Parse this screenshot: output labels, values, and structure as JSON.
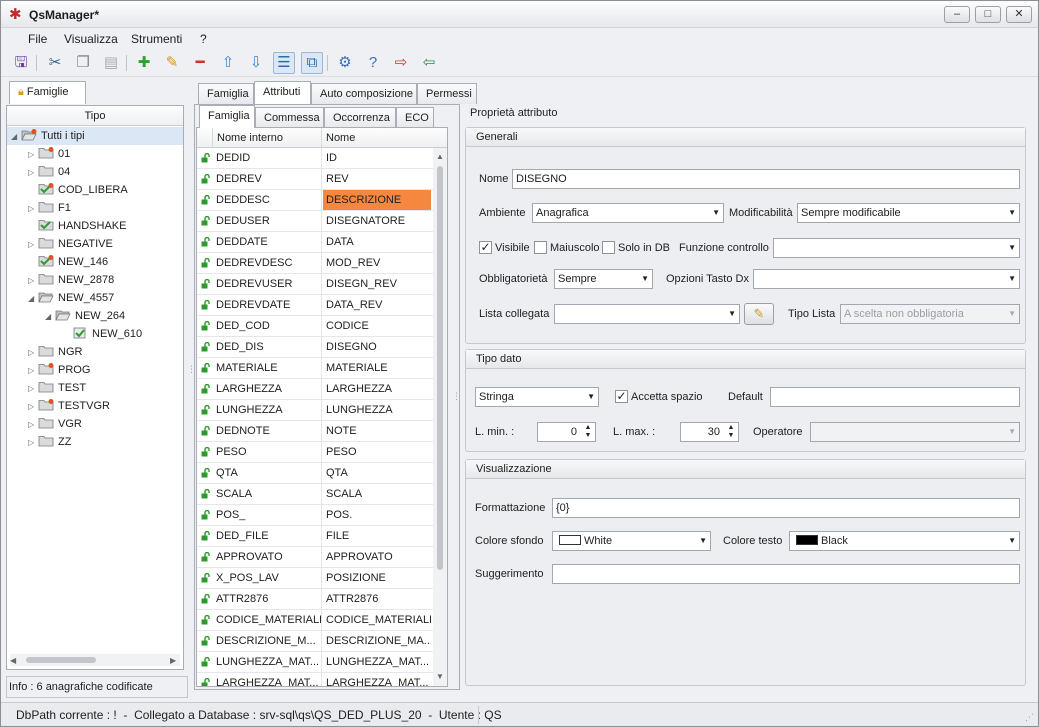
{
  "window": {
    "title": "QsManager*"
  },
  "menu": [
    "File",
    "Visualizza",
    "Strumenti",
    "?"
  ],
  "left_tab": "Famiglie",
  "tree": {
    "header": "Tipo",
    "root": "Tutti i tipi",
    "items": [
      {
        "label": "01",
        "depth": 1,
        "arrow": "right",
        "icon": "folder-star"
      },
      {
        "label": "04",
        "depth": 1,
        "arrow": "right",
        "icon": "folder"
      },
      {
        "label": "COD_LIBERA",
        "depth": 1,
        "arrow": "",
        "icon": "folder-check-star"
      },
      {
        "label": "F1",
        "depth": 1,
        "arrow": "right",
        "icon": "folder"
      },
      {
        "label": "HANDSHAKE",
        "depth": 1,
        "arrow": "",
        "icon": "folder-check"
      },
      {
        "label": "NEGATIVE",
        "depth": 1,
        "arrow": "right",
        "icon": "folder"
      },
      {
        "label": "NEW_146",
        "depth": 1,
        "arrow": "",
        "icon": "folder-check-star"
      },
      {
        "label": "NEW_2878",
        "depth": 1,
        "arrow": "right",
        "icon": "folder"
      },
      {
        "label": "NEW_4557",
        "depth": 1,
        "arrow": "down",
        "icon": "folder-open"
      },
      {
        "label": "NEW_264",
        "depth": 2,
        "arrow": "down",
        "icon": "folder-open"
      },
      {
        "label": "NEW_610",
        "depth": 3,
        "arrow": "",
        "icon": "check"
      },
      {
        "label": "NGR",
        "depth": 1,
        "arrow": "right",
        "icon": "folder"
      },
      {
        "label": "PROG",
        "depth": 1,
        "arrow": "right",
        "icon": "folder-star"
      },
      {
        "label": "TEST",
        "depth": 1,
        "arrow": "right",
        "icon": "folder"
      },
      {
        "label": "TESTVGR",
        "depth": 1,
        "arrow": "right",
        "icon": "folder-star"
      },
      {
        "label": "VGR",
        "depth": 1,
        "arrow": "right",
        "icon": "folder"
      },
      {
        "label": "ZZ",
        "depth": 1,
        "arrow": "right",
        "icon": "folder"
      }
    ]
  },
  "info": "Info : 6 anagrafiche codificate",
  "tabs_main": [
    "Famiglia",
    "Attributi",
    "Auto composizione",
    "Permessi"
  ],
  "tabs_sub": [
    "Famiglia",
    "Commessa",
    "Occorrenza",
    "ECO"
  ],
  "grid": {
    "headers": [
      "Nome interno",
      "Nome"
    ],
    "rows": [
      [
        "DEDID",
        "ID"
      ],
      [
        "DEDREV",
        "REV"
      ],
      [
        "DEDDESC",
        "DESCRIZIONE"
      ],
      [
        "DEDUSER",
        "DISEGNATORE"
      ],
      [
        "DEDDATE",
        "DATA"
      ],
      [
        "DEDREVDESC",
        "MOD_REV"
      ],
      [
        "DEDREVUSER",
        "DISEGN_REV"
      ],
      [
        "DEDREVDATE",
        "DATA_REV"
      ],
      [
        "DED_COD",
        "CODICE"
      ],
      [
        "DED_DIS",
        "DISEGNO"
      ],
      [
        "MATERIALE",
        "MATERIALE"
      ],
      [
        "LARGHEZZA",
        "LARGHEZZA"
      ],
      [
        "LUNGHEZZA",
        "LUNGHEZZA"
      ],
      [
        "DEDNOTE",
        "NOTE"
      ],
      [
        "PESO",
        "PESO"
      ],
      [
        "QTA",
        "QTA"
      ],
      [
        "SCALA",
        "SCALA"
      ],
      [
        "POS_",
        "POS."
      ],
      [
        "DED_FILE",
        "FILE"
      ],
      [
        "APPROVATO",
        "APPROVATO"
      ],
      [
        "X_POS_LAV",
        "POSIZIONE"
      ],
      [
        "ATTR2876",
        "ATTR2876"
      ],
      [
        "CODICE_MATERIALE",
        "CODICE_MATERIALE"
      ],
      [
        "DESCRIZIONE_M...",
        "DESCRIZIONE_MA..."
      ],
      [
        "LUNGHEZZA_MAT...",
        "LUNGHEZZA_MAT..."
      ],
      [
        "LARGHEZZA_MAT...",
        "LARGHEZZA_MAT..."
      ]
    ],
    "highlight_color": "#f5873f"
  },
  "props": {
    "title": "Proprietà attributo",
    "generali": {
      "header": "Generali",
      "nome_label": "Nome",
      "nome_value": "DISEGNO",
      "ambiente_label": "Ambiente",
      "ambiente_value": "Anagrafica",
      "modific_label": "Modificabilità",
      "modific_value": "Sempre modificabile",
      "visibile_label": "Visibile",
      "maiuscolo_label": "Maiuscolo",
      "solodb_label": "Solo in DB",
      "funzione_label": "Funzione controllo",
      "funzione_value": "",
      "obblig_label": "Obbligatorietà",
      "obblig_value": "Sempre",
      "opzioni_label": "Opzioni Tasto Dx",
      "opzioni_value": "",
      "lista_label": "Lista collegata",
      "lista_value": "",
      "tipolista_label": "Tipo Lista",
      "tipolista_value": "A scelta non obbligatoria"
    },
    "tipodato": {
      "header": "Tipo dato",
      "tipo_value": "Stringa",
      "accetta_label": "Accetta spazio",
      "default_label": "Default",
      "default_value": "",
      "lmin_label": "L. min. :",
      "lmin_value": "0",
      "lmax_label": "L. max. :",
      "lmax_value": "30",
      "operatore_label": "Operatore",
      "operatore_value": ""
    },
    "visual": {
      "header": "Visualizzazione",
      "formatt_label": "Formattazione",
      "formatt_value": "{0}",
      "sfondo_label": "Colore sfondo",
      "sfondo_value": "White",
      "sfondo_color": "#ffffff",
      "testo_label": "Colore testo",
      "testo_value": "Black",
      "testo_color": "#000000",
      "sugg_label": "Suggerimento",
      "sugg_value": ""
    }
  },
  "status": {
    "dbpath": "DbPath corrente : !",
    "db": "Collegato a Database : srv-sql\\qs\\QS_DED_PLUS_20",
    "user": "Utente : QS"
  }
}
